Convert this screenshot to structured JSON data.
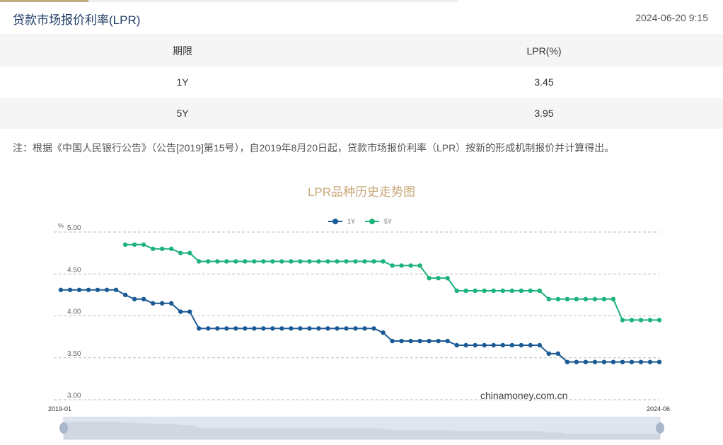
{
  "header": {
    "title": "贷款市场报价利率(LPR)",
    "datetime": "2024-06-20 9:15"
  },
  "table": {
    "columns": [
      "期限",
      "LPR(%)"
    ],
    "rows": [
      [
        "1Y",
        "3.45"
      ],
      [
        "5Y",
        "3.95"
      ]
    ]
  },
  "note": "注：根据《中国人民银行公告》（公告[2019]第15号），自2019年8月20日起，贷款市场报价利率（LPR）按新的形成机制报价并计算得出。",
  "chart_data": {
    "type": "line",
    "title": "LPR品种历史走势图",
    "ylabel": "%",
    "ylim": [
      3.0,
      5.0
    ],
    "yticks": [
      "5.00",
      "4.50",
      "4.00",
      "3.50",
      "3.00"
    ],
    "x_start_label": "2019-01",
    "x_end_label": "2024-06",
    "watermark": "chinamoney.com.cn",
    "grid": true,
    "legend": "top-center",
    "series": [
      {
        "name": "1Y",
        "color": "#1b5a94",
        "values": [
          4.31,
          4.31,
          4.31,
          4.31,
          4.31,
          4.31,
          4.31,
          4.25,
          4.2,
          4.2,
          4.15,
          4.15,
          4.15,
          4.05,
          4.05,
          3.85,
          3.85,
          3.85,
          3.85,
          3.85,
          3.85,
          3.85,
          3.85,
          3.85,
          3.85,
          3.85,
          3.85,
          3.85,
          3.85,
          3.85,
          3.85,
          3.85,
          3.85,
          3.85,
          3.85,
          3.8,
          3.7,
          3.7,
          3.7,
          3.7,
          3.7,
          3.7,
          3.7,
          3.65,
          3.65,
          3.65,
          3.65,
          3.65,
          3.65,
          3.65,
          3.65,
          3.65,
          3.65,
          3.55,
          3.55,
          3.45,
          3.45,
          3.45,
          3.45,
          3.45,
          3.45,
          3.45,
          3.45,
          3.45,
          3.45,
          3.45
        ]
      },
      {
        "name": "5Y",
        "color": "#1db37b",
        "values": [
          null,
          null,
          null,
          null,
          null,
          null,
          null,
          4.85,
          4.85,
          4.85,
          4.8,
          4.8,
          4.8,
          4.75,
          4.75,
          4.65,
          4.65,
          4.65,
          4.65,
          4.65,
          4.65,
          4.65,
          4.65,
          4.65,
          4.65,
          4.65,
          4.65,
          4.65,
          4.65,
          4.65,
          4.65,
          4.65,
          4.65,
          4.65,
          4.65,
          4.65,
          4.6,
          4.6,
          4.6,
          4.6,
          4.45,
          4.45,
          4.45,
          4.3,
          4.3,
          4.3,
          4.3,
          4.3,
          4.3,
          4.3,
          4.3,
          4.3,
          4.3,
          4.2,
          4.2,
          4.2,
          4.2,
          4.2,
          4.2,
          4.2,
          4.2,
          3.95,
          3.95,
          3.95,
          3.95,
          3.95
        ]
      }
    ]
  }
}
